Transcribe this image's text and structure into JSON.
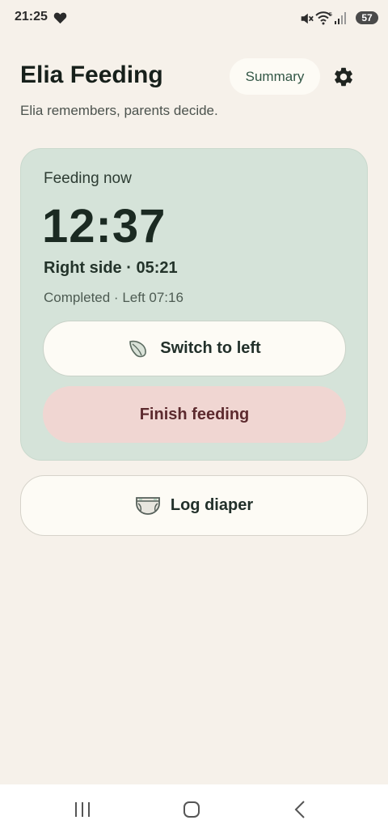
{
  "status_bar": {
    "time": "21:25",
    "battery": "57"
  },
  "header": {
    "title": "Elia Feeding",
    "summary_label": "Summary",
    "tagline": "Elia remembers, parents decide."
  },
  "feeding": {
    "label": "Feeding now",
    "timer": "12:37",
    "current_side": "Right side · 05:21",
    "completed": "Completed · Left 07:16",
    "switch_label": "Switch to left",
    "finish_label": "Finish feeding"
  },
  "diaper": {
    "label": "Log diaper"
  },
  "colors": {
    "background": "#f6f1ea",
    "card": "#d5e3d9",
    "finish": "#f0d6d2",
    "accent": "#335746"
  },
  "icons": [
    "heart-icon",
    "mute-icon",
    "wifi-icon",
    "signal-icon",
    "gear-icon",
    "leaf-icon",
    "diaper-icon",
    "recents-icon",
    "home-icon",
    "back-icon"
  ]
}
